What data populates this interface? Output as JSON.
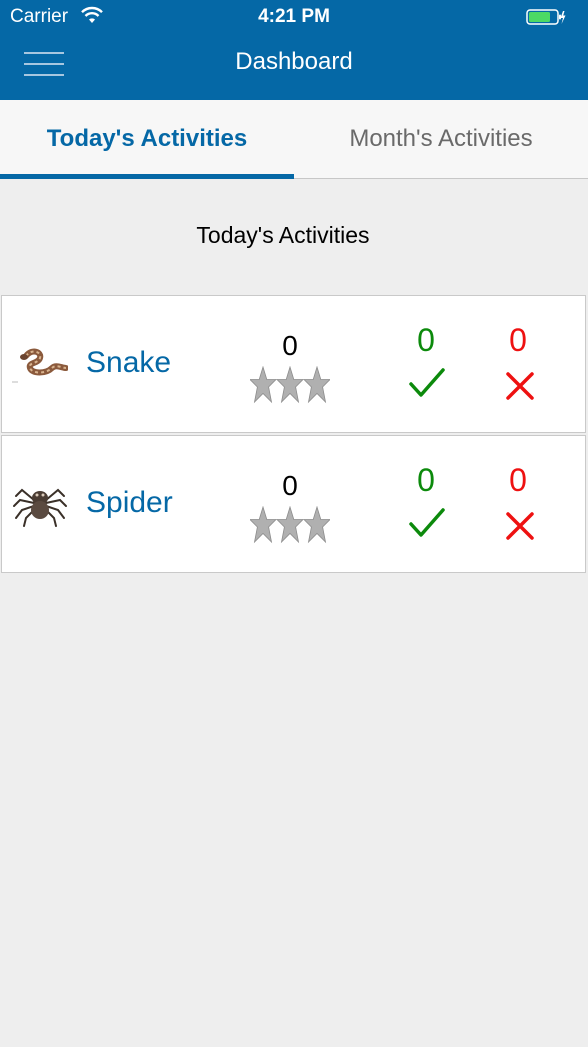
{
  "status_bar": {
    "carrier": "Carrier",
    "time": "4:21 PM"
  },
  "header": {
    "title": "Dashboard",
    "menu_icon": "hamburger-icon"
  },
  "tabs": [
    {
      "label": "Today's Activities",
      "active": true
    },
    {
      "label": "Month's Activities",
      "active": false
    }
  ],
  "section_title": "Today's Activities",
  "activities": [
    {
      "name": "Snake",
      "icon": "snake-image",
      "score": "0",
      "stars_filled": 0,
      "stars_total": 3,
      "correct": "0",
      "wrong": "0"
    },
    {
      "name": "Spider",
      "icon": "spider-image",
      "score": "0",
      "stars_filled": 0,
      "stars_total": 3,
      "correct": "0",
      "wrong": "0"
    }
  ],
  "colors": {
    "brand": "#0568a6",
    "correct": "#0c8a0c",
    "wrong": "#ee1111",
    "star": "#b0b0b0"
  }
}
